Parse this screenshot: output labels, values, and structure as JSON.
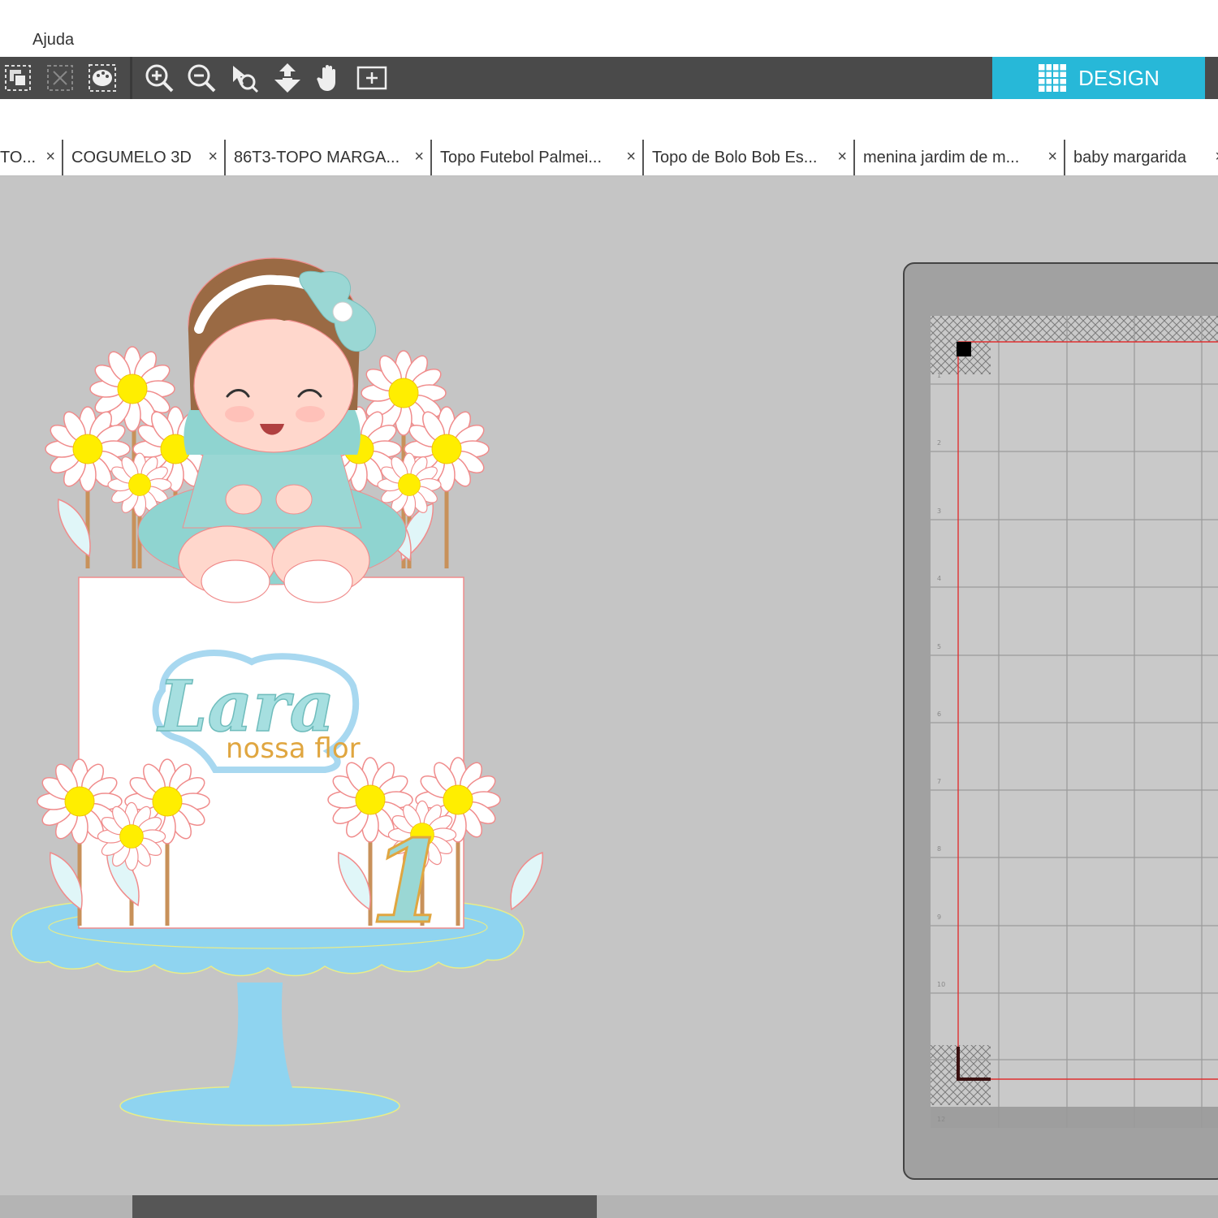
{
  "menu": {
    "help": "Ajuda"
  },
  "toolbar": {
    "icons": [
      "group-icon",
      "ungroup-icon",
      "color-palette-icon",
      "zoom-in-icon",
      "zoom-out-icon",
      "zoom-selection-icon",
      "move-down-icon",
      "pan-hand-icon",
      "fit-page-icon"
    ],
    "design_label": "DESIGN",
    "accent": "#27b8d8"
  },
  "tabs": [
    {
      "label": "TO..."
    },
    {
      "label": "COGUMELO 3D"
    },
    {
      "label": "86T3-TOPO MARGA..."
    },
    {
      "label": "Topo Futebol Palmei..."
    },
    {
      "label": "Topo de Bolo Bob Es..."
    },
    {
      "label": "menina jardim de m..."
    },
    {
      "label": "baby margarida"
    }
  ],
  "tab_close": "×",
  "artwork": {
    "name": "Lara",
    "subtitle": "nossa flor",
    "number": "1"
  },
  "mat": {
    "ruler_numbers": [
      "1",
      "2",
      "3",
      "4",
      "5",
      "6",
      "7",
      "8",
      "9",
      "10",
      "12"
    ]
  }
}
